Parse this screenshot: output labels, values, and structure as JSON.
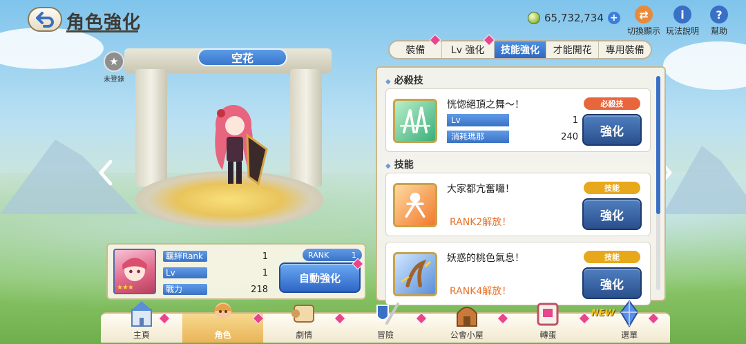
{
  "header": {
    "title": "角色強化",
    "currency_value": "65,732,734",
    "actions": [
      {
        "label": "切換顯示",
        "icon": "toggle-display-icon"
      },
      {
        "label": "玩法說明",
        "icon": "info-icon"
      },
      {
        "label": "幫助",
        "icon": "help-icon"
      }
    ]
  },
  "character": {
    "name": "空花",
    "registration_status": "未登錄"
  },
  "stats": {
    "rows": [
      {
        "label": "羈絆Rank",
        "value": "1"
      },
      {
        "label": "Lv",
        "value": "1"
      },
      {
        "label": "戰力",
        "value": "218"
      }
    ],
    "rank_label": "RANK",
    "rank_value": "1",
    "auto_enhance_label": "自動強化",
    "star_count": 3
  },
  "tabs": [
    {
      "label": "裝備",
      "active": false
    },
    {
      "label": "Lv 強化",
      "active": false
    },
    {
      "label": "技能強化",
      "active": true
    },
    {
      "label": "才能開花",
      "active": false
    },
    {
      "label": "專用裝備",
      "active": false
    }
  ],
  "skills": {
    "section_ultimate": "必殺技",
    "section_skills": "技能",
    "ultimate": {
      "name": "恍惚絕頂之舞～！",
      "type_label": "必殺技",
      "type_color": "#e8663c",
      "lv_label": "Lv",
      "lv_value": "1",
      "cost_label": "消耗瑪那",
      "cost_value": "240",
      "button_label": "強化"
    },
    "list": [
      {
        "name": "大家都亢奮囉！",
        "type_label": "技能",
        "type_color": "#e8a81c",
        "lock_text": "RANK2解放！",
        "button_label": "強化"
      },
      {
        "name": "妖惑的桃色氣息！",
        "type_label": "技能",
        "type_color": "#e8a81c",
        "lock_text": "RANK4解放！",
        "button_label": "強化"
      }
    ]
  },
  "nav": {
    "items": [
      {
        "label": "主頁",
        "icon": "castle-icon"
      },
      {
        "label": "角色",
        "icon": "character-icon",
        "active": true
      },
      {
        "label": "劇情",
        "icon": "scroll-icon"
      },
      {
        "label": "冒險",
        "icon": "sword-shield-icon"
      },
      {
        "label": "公會小屋",
        "icon": "guild-house-icon"
      },
      {
        "label": "轉蛋",
        "icon": "gacha-icon"
      },
      {
        "label": "選單",
        "icon": "menu-crystal-icon"
      }
    ],
    "new_badge": "NEW"
  }
}
